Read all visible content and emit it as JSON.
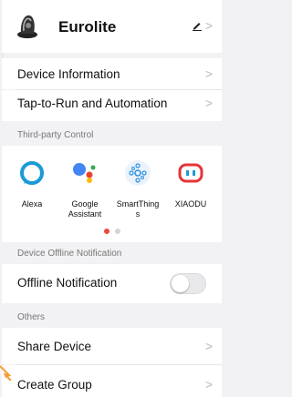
{
  "header": {
    "device_name": "Eurolite",
    "edit_icon": "pencil-icon",
    "chevron": ">"
  },
  "menu": {
    "device_information": "Device Information",
    "tap_to_run": "Tap-to-Run and Automation"
  },
  "third_party": {
    "section_title": "Third-party Control",
    "items": [
      {
        "name": "Alexa",
        "icon": "alexa-icon",
        "color": "#1a9bd7"
      },
      {
        "name": "Google\nAssistant",
        "icon": "google-assistant-icon",
        "color": "#4285f4"
      },
      {
        "name": "SmartThing\ns",
        "icon": "smartthings-icon",
        "color": "#2d8fe0"
      },
      {
        "name": "XIAODU",
        "icon": "xiaodu-icon",
        "color": "#e5343b"
      }
    ],
    "page_indicator": {
      "pages": 2,
      "active": 1
    }
  },
  "offline": {
    "section_title": "Device Offline Notification",
    "label": "Offline Notification",
    "enabled": false
  },
  "others": {
    "section_title": "Others",
    "share_device": "Share Device",
    "create_group": "Create Group"
  },
  "colors": {
    "accent": "#e74c3c",
    "arrow": "#f39c37"
  }
}
